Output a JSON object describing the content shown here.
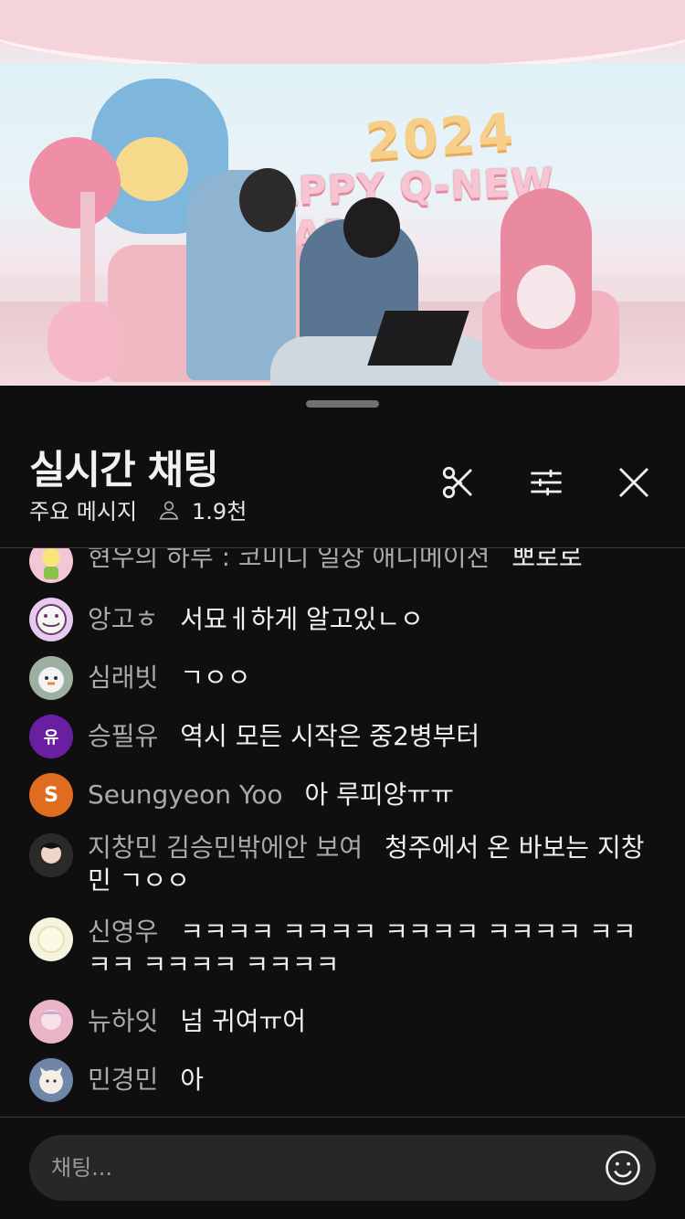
{
  "video": {
    "year_text": "2024",
    "banner_text": "HAPPY Q-NEW YEAR"
  },
  "chat": {
    "title": "실시간 채팅",
    "mode_label": "주요 메시지",
    "viewer_count": "1.9천",
    "icons": {
      "clip": "scissors-icon",
      "filter": "sliders-icon",
      "close": "close-icon",
      "viewers": "person-icon",
      "emoji": "smiley-icon"
    },
    "messages": [
      {
        "author": "현우의 하루 : 코미디 일상 애니메이션",
        "text": "뽀로로",
        "avatar_color": "#f2c6d6",
        "avatar_letter": ""
      },
      {
        "author": "앙고ㅎ",
        "text": "서묘ㅔ하게 알고있ㄴㅇ",
        "avatar_color": "#e8c9f0",
        "avatar_letter": ""
      },
      {
        "author": "심래빗",
        "text": "ㄱㅇㅇ",
        "avatar_color": "#9bb0a0",
        "avatar_letter": ""
      },
      {
        "author": "승필유",
        "text": "역시 모든 시작은 중2병부터",
        "avatar_color": "#6a1fa0",
        "avatar_letter": "유"
      },
      {
        "author": "Seungyeon Yoo",
        "text": "아 루피양ㅠㅠ",
        "avatar_color": "#e06c1f",
        "avatar_letter": "S"
      },
      {
        "author": "지창민 김승민밖에안 보여",
        "text": "청주에서 온 바보는 지창민 ㄱㅇㅇ",
        "avatar_color": "#3a3a3a",
        "avatar_letter": ""
      },
      {
        "author": "신영우",
        "text": "ㅋㅋㅋㅋ ㅋㅋㅋㅋ ㅋㅋㅋㅋ ㅋㅋㅋㅋ ㅋㅋㅋㅋ ㅋㅋㅋㅋ ㅋㅋㅋㅋ",
        "avatar_color": "#f6f3de",
        "avatar_letter": ""
      },
      {
        "author": "뉴하잇",
        "text": "넘 귀여ㅠ어",
        "avatar_color": "#e9b4c8",
        "avatar_letter": ""
      },
      {
        "author": "민경민",
        "text": "아",
        "avatar_color": "#6f86a8",
        "avatar_letter": ""
      }
    ],
    "input_placeholder": "채팅..."
  }
}
